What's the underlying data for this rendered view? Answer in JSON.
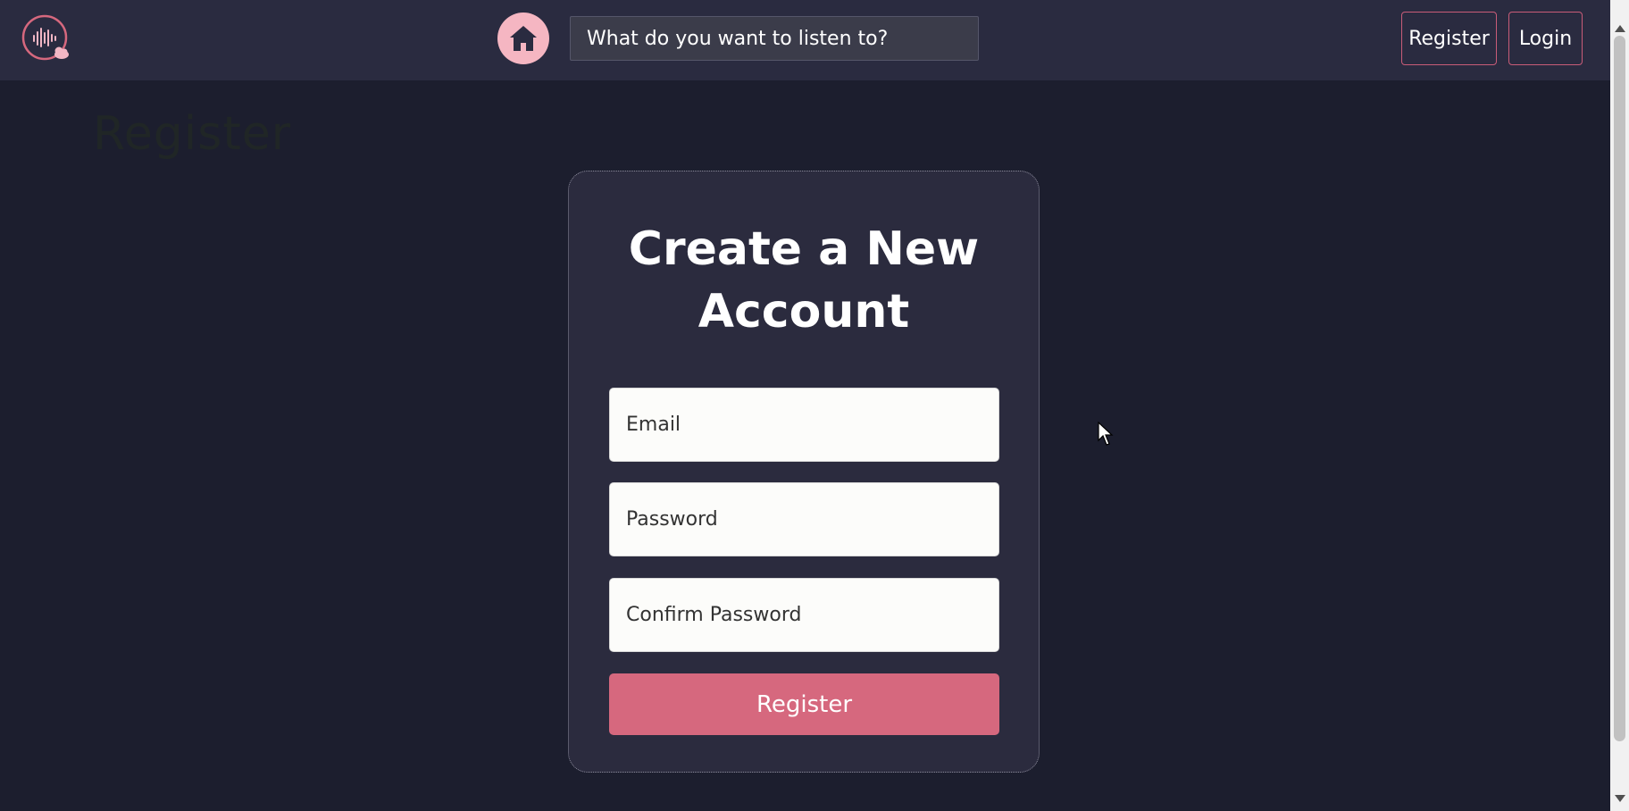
{
  "navbar": {
    "search_placeholder": "What do you want to listen to?",
    "register_label": "Register",
    "login_label": "Login",
    "logo_icon": "sound-wave-cloud-icon",
    "home_icon": "home-icon"
  },
  "page": {
    "ghost_heading": "Register"
  },
  "form": {
    "title_line1": "Create a New",
    "title_line2": "Account",
    "email_placeholder": "Email",
    "password_placeholder": "Password",
    "confirm_placeholder": "Confirm Password",
    "submit_label": "Register"
  },
  "colors": {
    "navbar_bg": "#2a2b40",
    "page_bg": "#1c1e2e",
    "accent": "#d6687e",
    "home_button": "#f5b6c2"
  }
}
